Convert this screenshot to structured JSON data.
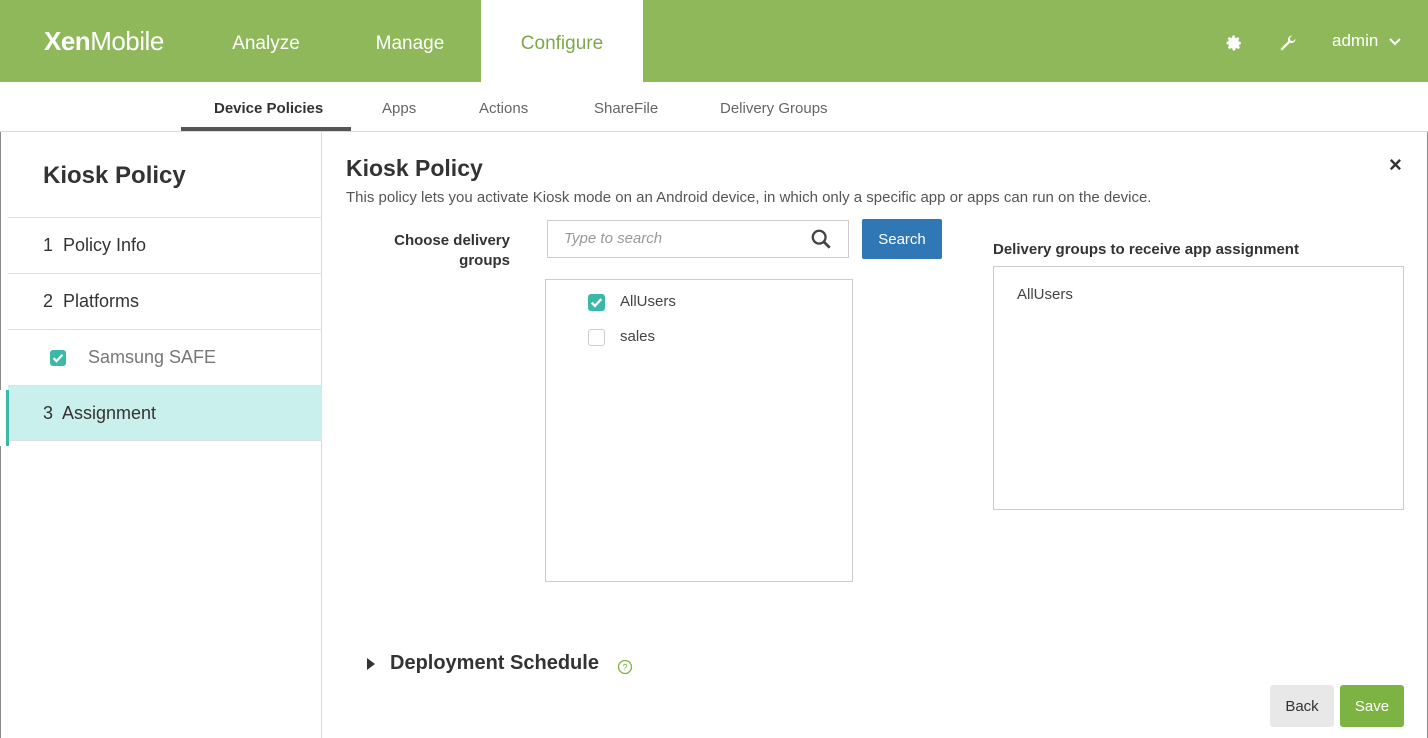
{
  "brand": {
    "bold": "Xen",
    "light": "Mobile"
  },
  "topnav": [
    {
      "label": "Analyze"
    },
    {
      "label": "Manage"
    },
    {
      "label": "Configure",
      "active": true
    }
  ],
  "user": {
    "label": "admin"
  },
  "icons": {
    "settings": "gear-icon",
    "tools": "wrench-icon",
    "dropdown": "chevron-down-icon",
    "search": "search-icon",
    "help": "help-circle-icon",
    "close": "close-icon",
    "expand": "triangle-right-icon"
  },
  "subnav": [
    {
      "label": "Device Policies",
      "active": true
    },
    {
      "label": "Apps"
    },
    {
      "label": "Actions"
    },
    {
      "label": "ShareFile"
    },
    {
      "label": "Delivery Groups"
    }
  ],
  "sidebar": {
    "title": "Kiosk Policy",
    "items": [
      {
        "label": "1  Policy Info"
      },
      {
        "label": "2  Platforms"
      },
      {
        "label": "Samsung SAFE",
        "checked": true
      },
      {
        "label": "3  Assignment",
        "active": true
      }
    ]
  },
  "main": {
    "title": "Kiosk Policy",
    "description": "This policy lets you activate Kiosk mode on an Android device, in which only a specific app or apps can run on the device.",
    "choose_label_line1": "Choose delivery",
    "choose_label_line2": "groups",
    "search_placeholder": "Type to search",
    "search_button": "Search",
    "groups": [
      {
        "label": "AllUsers",
        "checked": true
      },
      {
        "label": "sales",
        "checked": false
      }
    ],
    "assign_label": "Delivery groups to receive app assignment",
    "assigned": [
      "AllUsers"
    ],
    "deployment": "Deployment Schedule",
    "back": "Back",
    "save": "Save",
    "close": "×"
  },
  "colors": {
    "brand_green": "#8fb85a",
    "teal": "#3bb8a8",
    "search_blue": "#2f77b5",
    "save_green": "#7cb342",
    "active_bg": "#c9f0ec"
  }
}
